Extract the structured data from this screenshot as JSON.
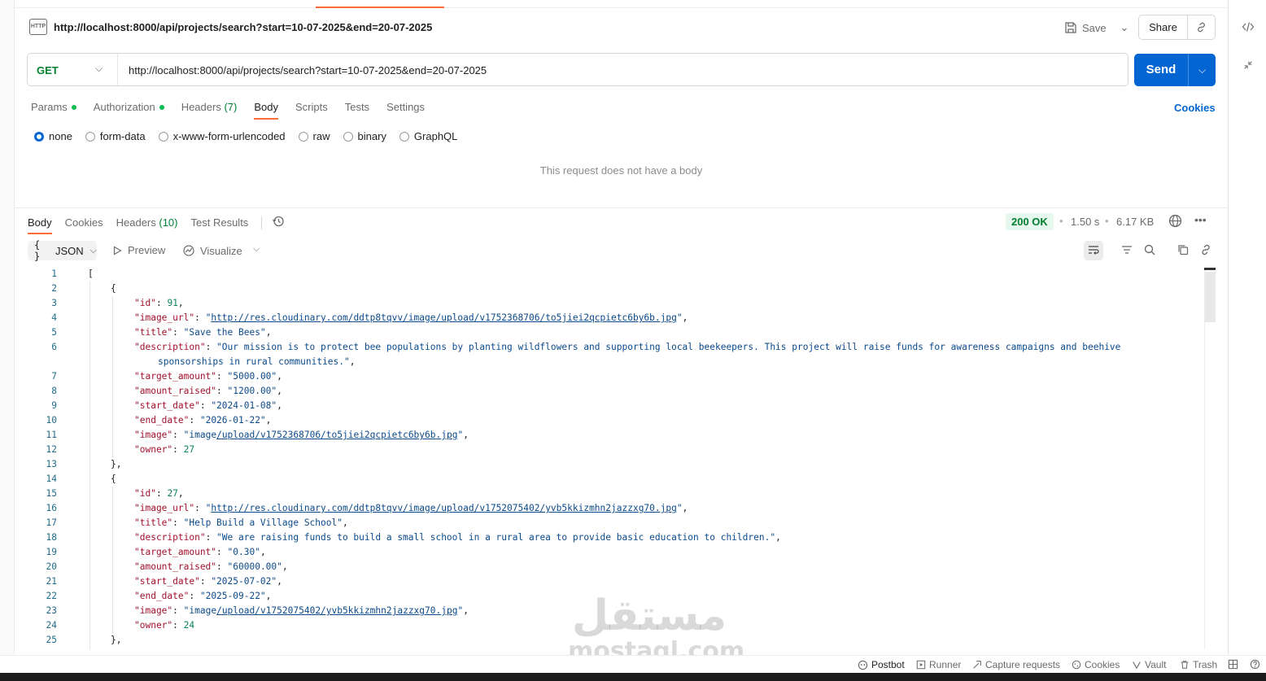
{
  "request": {
    "badge": "HTTP",
    "title": "http://localhost:8000/api/projects/search?start=10-07-2025&end=20-07-2025",
    "save_label": "Save",
    "share_label": "Share",
    "method": "GET",
    "url": "http://localhost:8000/api/projects/search?start=10-07-2025&end=20-07-2025",
    "send_label": "Send",
    "tabs": [
      {
        "label": "Params"
      },
      {
        "label": "Authorization"
      },
      {
        "label": "Headers",
        "count": "(7)"
      },
      {
        "label": "Body"
      },
      {
        "label": "Scripts"
      },
      {
        "label": "Tests"
      },
      {
        "label": "Settings"
      }
    ],
    "cookies_label": "Cookies",
    "body_types": [
      "none",
      "form-data",
      "x-www-form-urlencoded",
      "raw",
      "binary",
      "GraphQL"
    ],
    "no_body_text": "This request does not have a body"
  },
  "response": {
    "tabs": [
      {
        "label": "Body"
      },
      {
        "label": "Cookies"
      },
      {
        "label": "Headers",
        "count": "(10)"
      },
      {
        "label": "Test Results"
      }
    ],
    "status": "200 OK",
    "time": "1.50 s",
    "size": "6.17 KB",
    "format_label": "JSON",
    "preview_label": "Preview",
    "visualize_label": "Visualize"
  },
  "code_lines": [
    {
      "n": "1"
    },
    {
      "n": "2"
    },
    {
      "n": "3"
    },
    {
      "n": "4"
    },
    {
      "n": "5"
    },
    {
      "n": "6"
    },
    {
      "n": ""
    },
    {
      "n": "7"
    },
    {
      "n": "8"
    },
    {
      "n": "9"
    },
    {
      "n": "10"
    },
    {
      "n": "11"
    },
    {
      "n": "12"
    },
    {
      "n": "13"
    },
    {
      "n": "14"
    },
    {
      "n": "15"
    },
    {
      "n": "16"
    },
    {
      "n": "17"
    },
    {
      "n": "18"
    },
    {
      "n": "19"
    },
    {
      "n": "20"
    },
    {
      "n": "21"
    },
    {
      "n": "22"
    },
    {
      "n": "23"
    },
    {
      "n": "24"
    },
    {
      "n": "25"
    }
  ],
  "json_text": {
    "k_id": "\"id\"",
    "k_image_url": "\"image_url\"",
    "k_title": "\"title\"",
    "k_description": "\"description\"",
    "k_target_amount": "\"target_amount\"",
    "k_amount_raised": "\"amount_raised\"",
    "k_start_date": "\"start_date\"",
    "k_end_date": "\"end_date\"",
    "k_image": "\"image\"",
    "k_owner": "\"owner\"",
    "p1": {
      "id": "91",
      "image_url": "http://res.cloudinary.com/ddtp8tqvv/image/upload/v1752368706/to5jiei2qcpietc6by6b.jpg",
      "title": "\"Save the Bees\"",
      "description_1": "\"Our mission is to protect bee populations by planting wildflowers and supporting local beekeepers. This project will raise funds for awareness campaigns and beehive",
      "description_2": "sponsorships in rural communities.\"",
      "target_amount": "\"5000.00\"",
      "amount_raised": "\"1200.00\"",
      "start_date": "\"2024-01-08\"",
      "end_date": "\"2026-01-22\"",
      "image_prefix": "image",
      "image_link": "/upload/v1752368706/to5jiei2qcpietc6by6b.jpg",
      "owner": "27"
    },
    "p2": {
      "id": "27",
      "image_url": "http://res.cloudinary.com/ddtp8tqvv/image/upload/v1752075402/yvb5kkizmhn2jazzxg70.jpg",
      "title": "\"Help Build a Village School\"",
      "description": "\"We are raising funds to build a small school in a rural area to provide basic education to children.\"",
      "target_amount": "\"0.30\"",
      "amount_raised": "\"60000.00\"",
      "start_date": "\"2025-07-02\"",
      "end_date": "\"2025-09-22\"",
      "image_prefix": "image",
      "image_link": "/upload/v1752075402/yvb5kkizmhn2jazzxg70.jpg",
      "owner": "24"
    }
  },
  "statusbar": {
    "postbot": "Postbot",
    "runner": "Runner",
    "capture": "Capture requests",
    "cookies": "Cookies",
    "vault": "Vault",
    "trash": "Trash"
  },
  "watermark": {
    "arabic": "مستقل",
    "latin": "mostaql.com"
  },
  "colors": {
    "accent": "#ff6c37",
    "send": "#0265d2",
    "method_get": "#007f31",
    "status_ok": "#007f31"
  },
  "icons": [
    "http-icon",
    "save-icon",
    "link-icon",
    "code-icon",
    "history-icon",
    "globe-icon",
    "more-icon",
    "wrap-icon",
    "filter-icon",
    "search-icon",
    "copy-icon"
  ]
}
